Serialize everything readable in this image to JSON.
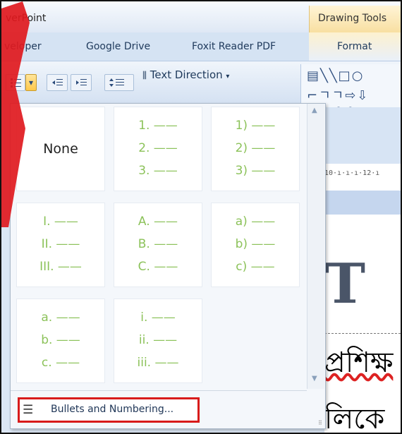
{
  "titlebar": {
    "app_title": "verPoint",
    "contextual_tab": "Drawing Tools"
  },
  "tabs": [
    "veloper",
    "Google Drive",
    "Foxit Reader PDF",
    "Format"
  ],
  "ribbon": {
    "text_direction": "Text Direction",
    "dropdown_arrow": "▾"
  },
  "gallery": {
    "none_label": "None",
    "cells": [
      [
        "1. ——",
        "2. ——",
        "3. ——"
      ],
      [
        "1) ——",
        "2) ——",
        "3) ——"
      ],
      [
        "I. ——",
        "II. ——",
        "III. ——"
      ],
      [
        "A. ——",
        "B. ——",
        "C. ——"
      ],
      [
        "a) ——",
        "b) ——",
        "c) ——"
      ],
      [
        "a. ——",
        "b. ——",
        "c. ——"
      ],
      [
        "i. ——",
        "ii. ——",
        "iii. ——"
      ]
    ],
    "menu_item": "Bullets and Numbering..."
  },
  "document": {
    "ruler_text": "10·ı·ı·ı·12·ı",
    "big_letter": "T",
    "bengali_line1": "প্রশিক্ষ",
    "bengali_line2": "লিকে"
  },
  "colors": {
    "numbering_green": "#8cc25a",
    "highlight_red": "#d81b1b"
  }
}
